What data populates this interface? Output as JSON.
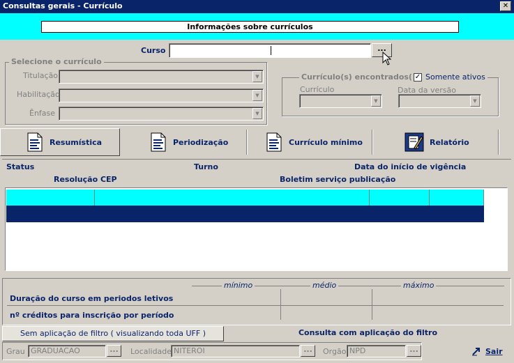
{
  "window": {
    "title": "Consultas gerais - Currículo",
    "close_glyph": "✕"
  },
  "banner": {
    "text": "Informações sobre currículos"
  },
  "curso": {
    "label": "Curso",
    "value": "",
    "lookup_label": "..."
  },
  "selecione": {
    "legend": "Selecione o currículo",
    "titulacao_label": "Titulação",
    "habilitacao_label": "Habilitação",
    "enfase_label": "Ênfase"
  },
  "encontrados": {
    "legend": "Currículo(s) encontrados(s)",
    "somente_ativos_label": "Somente ativos",
    "somente_ativos_checked": true,
    "curriculo_label": "Currículo",
    "data_versao_label": "Data da versão"
  },
  "tabs": [
    {
      "label": "Resumística",
      "icon": "document-icon"
    },
    {
      "label": "Periodização",
      "icon": "document-icon"
    },
    {
      "label": "Currículo mínimo",
      "icon": "document-icon"
    },
    {
      "label": "Relatório",
      "icon": "report-icon"
    }
  ],
  "info_headers": {
    "status": "Status",
    "turno": "Turno",
    "data_inicio": "Data do início de vigência",
    "resolucao": "Resolução CEP",
    "boletim": "Boletim serviço publicação"
  },
  "durations": {
    "minimo": "mínimo",
    "medio": "médio",
    "maximo": "máximo",
    "duracao_label": "Duração do curso em periodos letivos",
    "creditos_label": "nº créditos para inscrição por período"
  },
  "filters": {
    "sem_filtro": "Sem aplicação de filtro ( visualizando toda UFF )",
    "com_filtro": "Consulta com aplicação do filtro"
  },
  "bottom": {
    "grau_label": "Grau",
    "grau_value": "GRADUACAO",
    "localidade_label": "Localidade",
    "localidade_value": "NITEROI",
    "orgao_label": "Orgão",
    "orgao_value": "NPD",
    "lookup_label": "...",
    "sair_label": "Sair"
  },
  "colors": {
    "title_bar": "#0a246a",
    "accent_cyan": "#00ffff",
    "label_blue": "#0a246a",
    "face": "#d4d0c8"
  }
}
